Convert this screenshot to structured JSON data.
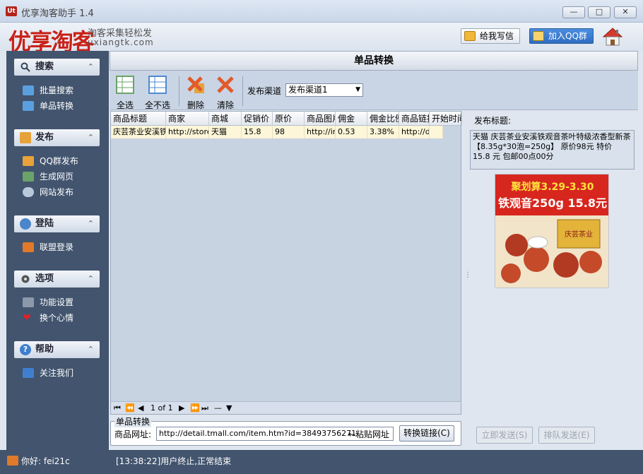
{
  "window": {
    "title": "优享淘客助手 1.4",
    "app_icon": "Ut"
  },
  "brand": {
    "logo": "优享淘客",
    "slogan": "淘客采集轻松发",
    "domain": "uxiangtk.com"
  },
  "header": {
    "mail_button": "给我写信",
    "qq_button": "加入QQ群"
  },
  "sidebar": {
    "sections": [
      {
        "title": "搜索",
        "items": [
          "批量搜索",
          "单品转换"
        ]
      },
      {
        "title": "发布",
        "items": [
          "QQ群发布",
          "生成网页",
          "网站发布"
        ]
      },
      {
        "title": "登陆",
        "items": [
          "联盟登录"
        ]
      },
      {
        "title": "选项",
        "items": [
          "功能设置",
          "换个心情"
        ]
      },
      {
        "title": "帮助",
        "items": [
          "关注我们"
        ]
      }
    ]
  },
  "panel": {
    "title": "单品转换"
  },
  "toolbar": {
    "select_all": "全选",
    "deselect_all": "全不选",
    "delete": "删除",
    "clear": "清除",
    "channel_label": "发布渠道",
    "channel_value": "发布渠道1"
  },
  "table": {
    "columns": [
      "商品标题",
      "商家",
      "商城",
      "促销价",
      "原价",
      "商品图片",
      "佣金",
      "佣金比例",
      "商品链接",
      "开始时间"
    ],
    "rows": [
      [
        "庆芸茶业安溪铁观音",
        "http://store",
        "天猫",
        "15.8",
        "98",
        "http://im",
        "0.53",
        "3.38%",
        "http://de",
        ""
      ]
    ],
    "pager": {
      "info": "1 of 1"
    }
  },
  "convert": {
    "legend": "单品转换",
    "url_label": "商品网址:",
    "url_value": "http://detail.tmall.com/item.htm?id=38493756271",
    "paste_hint": "←粘贴网址",
    "convert_button": "转换链接(C)"
  },
  "preview": {
    "label": "发布标题:",
    "text": "天猫 庆芸茶业安溪铁观音茶叶特级浓香型新茶【8.35g*30泡=250g】 原价98元 特价 15.8 元 包邮00点00分",
    "banner_line1": "聚划算3.29-3.30",
    "banner_line2": "铁观音250g 15.8元",
    "pack_text": "庆芸茶业"
  },
  "actions": {
    "send_now": "立即发送(S)",
    "queue_send": "排队发送(E)"
  },
  "status": {
    "user": "你好: fei21c",
    "message": "[13:38:22]用户终止,正常结束"
  },
  "colors": {
    "sidebar_bg": "#42546e",
    "brand_red": "#c7221a",
    "row_highlight": "#fdf6d8",
    "qq_blue": "#2d6dc2"
  }
}
